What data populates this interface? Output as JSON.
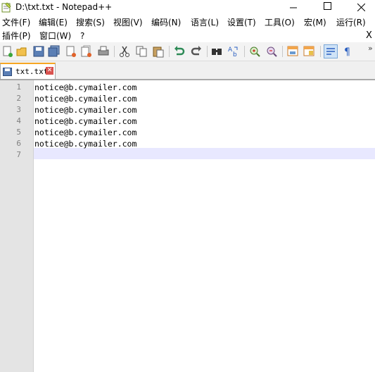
{
  "window": {
    "title": "D:\\txt.txt - Notepad++"
  },
  "menu": {
    "row1": [
      "文件(F)",
      "编辑(E)",
      "搜索(S)",
      "视图(V)",
      "编码(N)",
      "语言(L)",
      "设置(T)",
      "工具(O)",
      "宏(M)",
      "运行(R)"
    ],
    "row2": [
      "插件(P)",
      "窗口(W)",
      "?"
    ],
    "close_glyph": "X"
  },
  "toolbar": {
    "icons": [
      "new-file-icon",
      "open-file-icon",
      "save-icon",
      "save-all-icon",
      "close-icon",
      "close-all-icon",
      "print-icon",
      "cut-icon",
      "copy-icon",
      "paste-icon",
      "undo-icon",
      "redo-icon",
      "find-icon",
      "replace-icon",
      "zoom-in-icon",
      "zoom-out-icon",
      "sync-v-icon",
      "sync-h-icon",
      "word-wrap-icon",
      "show-all-chars-icon"
    ],
    "overflow_glyph": "»"
  },
  "tab": {
    "label": "txt.txt",
    "close_glyph": "✕"
  },
  "editor": {
    "line_numbers": [
      "1",
      "2",
      "3",
      "4",
      "5",
      "6",
      "7"
    ],
    "lines": [
      "notice@b.cymailer.com",
      "notice@b.cymailer.com",
      "notice@b.cymailer.com",
      "notice@b.cymailer.com",
      "notice@b.cymailer.com",
      "notice@b.cymailer.com",
      ""
    ]
  },
  "colors": {
    "gutter": "#e4e4e4",
    "current_line": "#e8e8ff",
    "tab_accent": "#f6a623"
  }
}
